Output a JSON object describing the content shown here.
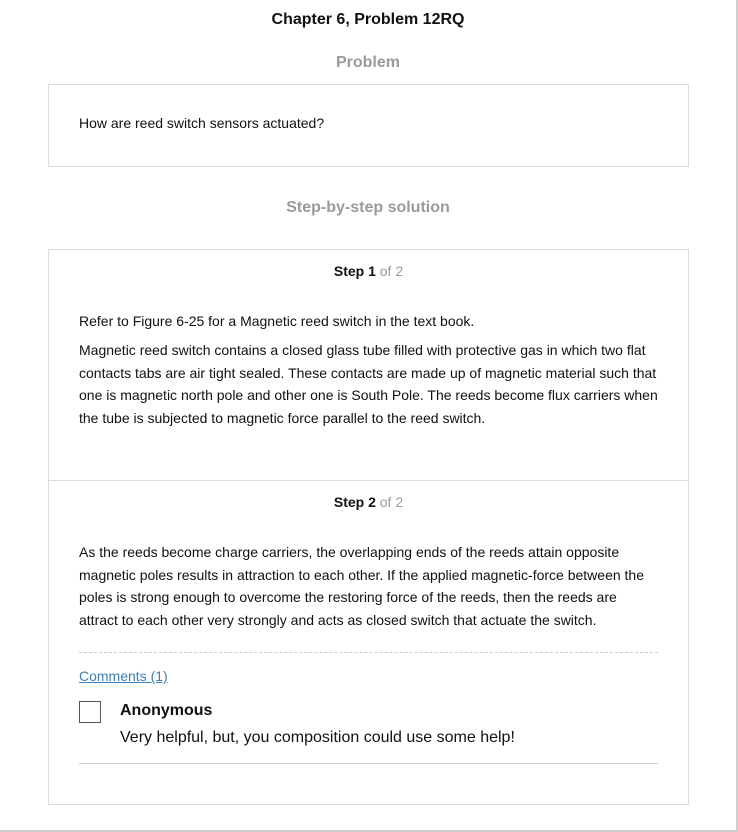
{
  "page_title": "Chapter 6, Problem 12RQ",
  "problem": {
    "heading": "Problem",
    "text": "How are reed switch sensors actuated?"
  },
  "solution": {
    "heading": "Step-by-step solution",
    "steps": [
      {
        "label": "Step 1",
        "of": "of 2",
        "paragraphs": [
          "Refer to Figure 6-25 for a Magnetic reed switch in the text book.",
          "Magnetic reed switch contains a closed glass tube filled with protective gas in which two flat contacts tabs are air tight sealed. These contacts are made up of magnetic material such that one is magnetic north pole and other one is South Pole. The reeds become flux carriers when the tube is subjected to magnetic force parallel to the reed switch."
        ]
      },
      {
        "label": "Step 2",
        "of": "of 2",
        "paragraphs": [
          "As the reeds become charge carriers, the overlapping ends of the reeds attain opposite magnetic poles results in attraction to each other. If the applied magnetic-force between the poles is strong enough to overcome the restoring force of the reeds, then the reeds are attract to each other very strongly and acts as closed switch that actuate the switch."
        ]
      }
    ]
  },
  "comments": {
    "link_label": "Comments (1)",
    "items": [
      {
        "author": "Anonymous",
        "text": "Very helpful, but, you composition could use some help!"
      }
    ]
  },
  "colors": {
    "heading_gray": "#9a9a9a",
    "link_blue": "#3a7fb6",
    "border": "#dcdcdc"
  }
}
